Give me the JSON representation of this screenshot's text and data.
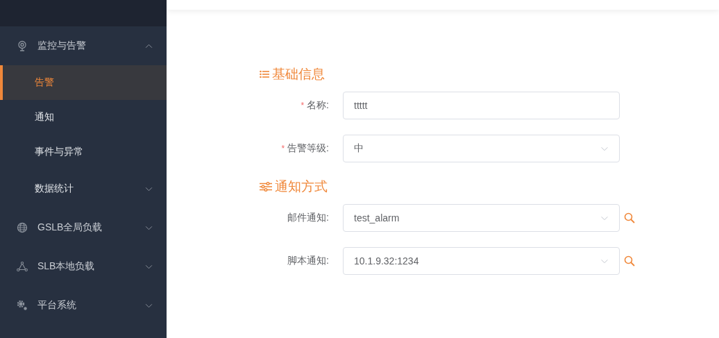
{
  "sidebar": {
    "groups": [
      {
        "label": "监控与告警",
        "expanded": true,
        "children": [
          {
            "label": "告警",
            "selected": true
          },
          {
            "label": "通知",
            "selected": false
          },
          {
            "label": "事件与异常",
            "selected": false
          },
          {
            "label": "数据统计",
            "selected": false,
            "expanded": false
          }
        ]
      },
      {
        "label": "GSLB全局负载",
        "expanded": false
      },
      {
        "label": "SLB本地负载",
        "expanded": false
      },
      {
        "label": "平台系统",
        "expanded": false
      }
    ]
  },
  "form": {
    "sections": [
      {
        "title": "基础信息",
        "fields": [
          {
            "label": "名称:",
            "required_mark": "*",
            "kind": "input",
            "value": "ttttt"
          },
          {
            "label": "告警等级:",
            "required_mark": "*",
            "kind": "select",
            "value": "中"
          }
        ]
      },
      {
        "title": "通知方式",
        "fields": [
          {
            "label": "邮件通知:",
            "kind": "select",
            "value": "test_alarm",
            "search": true
          },
          {
            "label": "脚本通知:",
            "kind": "select",
            "value": "10.1.9.32:1234",
            "search": true
          }
        ]
      }
    ]
  }
}
